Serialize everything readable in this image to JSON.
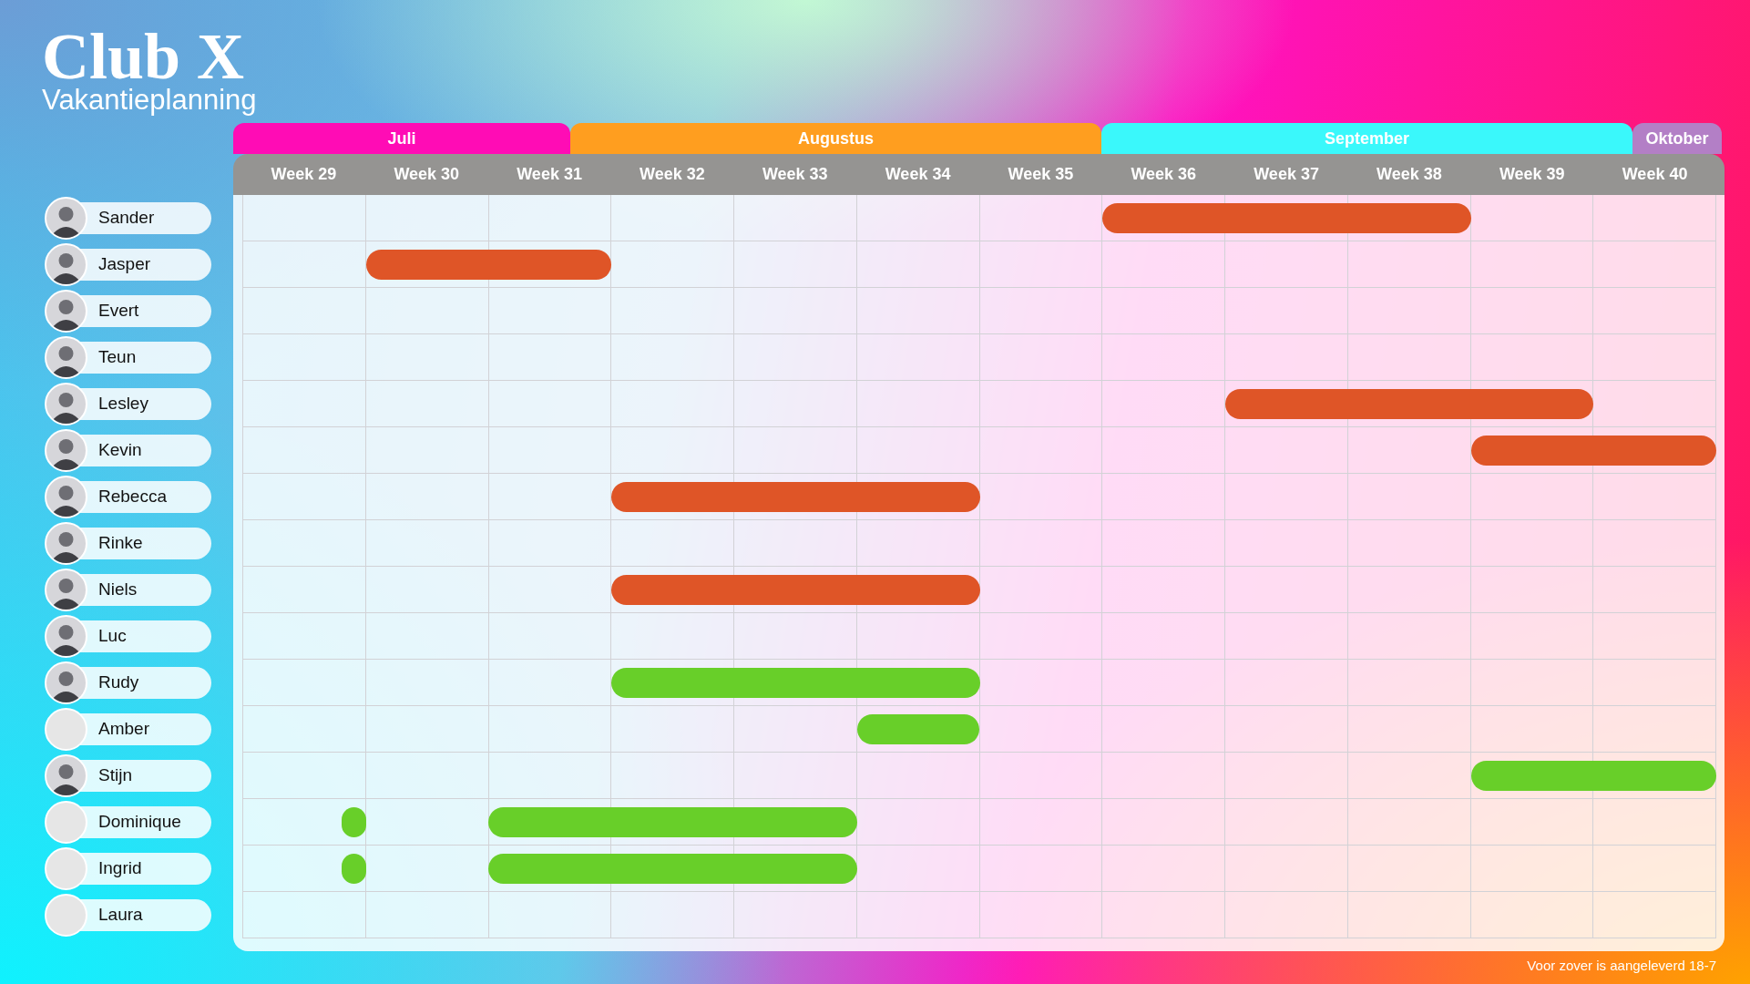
{
  "header": {
    "title": "Club X",
    "subtitle": "Vakantieplanning"
  },
  "months": [
    {
      "label": "Juli",
      "color": "#ff0cb5"
    },
    {
      "label": "Augustus",
      "color": "#ff9e1f"
    },
    {
      "label": "September",
      "color": "#3af8fb"
    },
    {
      "label": "Oktober",
      "color": "#b37fc6"
    }
  ],
  "weeks": [
    "Week 29",
    "Week 30",
    "Week 31",
    "Week 32",
    "Week 33",
    "Week 34",
    "Week 35",
    "Week 36",
    "Week 37",
    "Week 38",
    "Week 39",
    "Week 40"
  ],
  "people": [
    {
      "name": "Sander",
      "photo": true,
      "color": "#df5527",
      "schedule": [
        {
          "kind": "free"
        },
        {
          "kind": "free"
        },
        {
          "kind": "free"
        },
        {
          "kind": "free"
        },
        {
          "kind": "free"
        },
        {
          "kind": "free"
        },
        {
          "kind": "free"
        },
        {
          "kind": "week"
        },
        {
          "kind": "week"
        },
        {
          "kind": "week"
        },
        {
          "kind": "free"
        },
        {
          "kind": "free"
        }
      ]
    },
    {
      "name": "Jasper",
      "photo": true,
      "color": "#df5527",
      "schedule": [
        {
          "kind": "free"
        },
        {
          "kind": "week"
        },
        {
          "kind": "week"
        },
        {
          "kind": "free"
        },
        {
          "kind": "free"
        },
        {
          "kind": "free"
        },
        {
          "kind": "free"
        },
        {
          "kind": "free"
        },
        {
          "kind": "free"
        },
        {
          "kind": "free"
        },
        {
          "kind": "free"
        },
        {
          "kind": "free"
        }
      ]
    },
    {
      "name": "Evert",
      "photo": true,
      "schedule": [
        {
          "kind": "free"
        },
        {
          "kind": "free"
        },
        {
          "kind": "free"
        },
        {
          "kind": "free"
        },
        {
          "kind": "free"
        },
        {
          "kind": "free"
        },
        {
          "kind": "free"
        },
        {
          "kind": "free"
        },
        {
          "kind": "free"
        },
        {
          "kind": "free"
        },
        {
          "kind": "free"
        },
        {
          "kind": "free"
        }
      ]
    },
    {
      "name": "Teun",
      "photo": true,
      "schedule": [
        {
          "kind": "free"
        },
        {
          "kind": "free"
        },
        {
          "kind": "free"
        },
        {
          "kind": "free"
        },
        {
          "kind": "free"
        },
        {
          "kind": "free"
        },
        {
          "kind": "free"
        },
        {
          "kind": "free"
        },
        {
          "kind": "free"
        },
        {
          "kind": "free"
        },
        {
          "kind": "free"
        },
        {
          "kind": "free"
        }
      ]
    },
    {
      "name": "Lesley",
      "photo": true,
      "color": "#df5527",
      "schedule": [
        {
          "kind": "free"
        },
        {
          "kind": "free"
        },
        {
          "kind": "free"
        },
        {
          "kind": "free"
        },
        {
          "kind": "free"
        },
        {
          "kind": "free"
        },
        {
          "kind": "free"
        },
        {
          "kind": "free"
        },
        {
          "kind": "week"
        },
        {
          "kind": "week"
        },
        {
          "kind": "week"
        },
        {
          "kind": "free"
        }
      ]
    },
    {
      "name": "Kevin",
      "photo": true,
      "color": "#df5527",
      "schedule": [
        {
          "kind": "free"
        },
        {
          "kind": "free"
        },
        {
          "kind": "free"
        },
        {
          "kind": "free"
        },
        {
          "kind": "free"
        },
        {
          "kind": "free"
        },
        {
          "kind": "free"
        },
        {
          "kind": "free"
        },
        {
          "kind": "free"
        },
        {
          "kind": "free"
        },
        {
          "kind": "week"
        },
        {
          "kind": "week"
        }
      ]
    },
    {
      "name": "Rebecca",
      "photo": true,
      "color": "#df5527",
      "schedule": [
        {
          "kind": "free"
        },
        {
          "kind": "free"
        },
        {
          "kind": "free"
        },
        {
          "kind": "week"
        },
        {
          "kind": "week"
        },
        {
          "kind": "week"
        },
        {
          "kind": "free"
        },
        {
          "kind": "free"
        },
        {
          "kind": "free"
        },
        {
          "kind": "free"
        },
        {
          "kind": "free"
        },
        {
          "kind": "free"
        }
      ]
    },
    {
      "name": "Rinke",
      "photo": true,
      "schedule": [
        {
          "kind": "free"
        },
        {
          "kind": "free"
        },
        {
          "kind": "free"
        },
        {
          "kind": "free"
        },
        {
          "kind": "free"
        },
        {
          "kind": "free"
        },
        {
          "kind": "free"
        },
        {
          "kind": "free"
        },
        {
          "kind": "free"
        },
        {
          "kind": "free"
        },
        {
          "kind": "free"
        },
        {
          "kind": "free"
        }
      ]
    },
    {
      "name": "Niels",
      "photo": true,
      "color": "#df5527",
      "schedule": [
        {
          "kind": "free"
        },
        {
          "kind": "free"
        },
        {
          "kind": "free"
        },
        {
          "kind": "week"
        },
        {
          "kind": "week"
        },
        {
          "kind": "week"
        },
        {
          "kind": "free"
        },
        {
          "kind": "free"
        },
        {
          "kind": "free"
        },
        {
          "kind": "free"
        },
        {
          "kind": "free"
        },
        {
          "kind": "free"
        }
      ]
    },
    {
      "name": "Luc",
      "photo": true,
      "schedule": [
        {
          "kind": "free"
        },
        {
          "kind": "free"
        },
        {
          "kind": "free"
        },
        {
          "kind": "free"
        },
        {
          "kind": "free"
        },
        {
          "kind": "free"
        },
        {
          "kind": "free"
        },
        {
          "kind": "free"
        },
        {
          "kind": "free"
        },
        {
          "kind": "free"
        },
        {
          "kind": "free"
        },
        {
          "kind": "free"
        }
      ]
    },
    {
      "name": "Rudy",
      "photo": true,
      "color": "#68cf29",
      "schedule": [
        {
          "kind": "free"
        },
        {
          "kind": "free"
        },
        {
          "kind": "free"
        },
        {
          "kind": "week"
        },
        {
          "kind": "week"
        },
        {
          "kind": "week"
        },
        {
          "kind": "free"
        },
        {
          "kind": "free"
        },
        {
          "kind": "free"
        },
        {
          "kind": "free"
        },
        {
          "kind": "free"
        },
        {
          "kind": "free"
        }
      ]
    },
    {
      "name": "Amber",
      "photo": false,
      "color": "#68cf29",
      "schedule": [
        {
          "kind": "free"
        },
        {
          "kind": "free"
        },
        {
          "kind": "free"
        },
        {
          "kind": "free"
        },
        {
          "kind": "free"
        },
        {
          "kind": "week"
        },
        {
          "kind": "free"
        },
        {
          "kind": "free"
        },
        {
          "kind": "free"
        },
        {
          "kind": "free"
        },
        {
          "kind": "free"
        },
        {
          "kind": "free"
        }
      ]
    },
    {
      "name": "Stijn",
      "photo": true,
      "color": "#68cf29",
      "schedule": [
        {
          "kind": "free"
        },
        {
          "kind": "free"
        },
        {
          "kind": "free"
        },
        {
          "kind": "free"
        },
        {
          "kind": "free"
        },
        {
          "kind": "free"
        },
        {
          "kind": "free"
        },
        {
          "kind": "free"
        },
        {
          "kind": "free"
        },
        {
          "kind": "free"
        },
        {
          "kind": "week"
        },
        {
          "kind": "week"
        }
      ]
    },
    {
      "name": "Dominique",
      "photo": false,
      "color": "#68cf29",
      "schedule": [
        {
          "kind": "day"
        },
        {
          "kind": "free"
        },
        {
          "kind": "week"
        },
        {
          "kind": "week"
        },
        {
          "kind": "week"
        },
        {
          "kind": "free"
        },
        {
          "kind": "free"
        },
        {
          "kind": "free"
        },
        {
          "kind": "free"
        },
        {
          "kind": "free"
        },
        {
          "kind": "free"
        },
        {
          "kind": "free"
        }
      ]
    },
    {
      "name": "Ingrid",
      "photo": false,
      "color": "#68cf29",
      "schedule": [
        {
          "kind": "day"
        },
        {
          "kind": "free"
        },
        {
          "kind": "week"
        },
        {
          "kind": "week"
        },
        {
          "kind": "week"
        },
        {
          "kind": "free"
        },
        {
          "kind": "free"
        },
        {
          "kind": "free"
        },
        {
          "kind": "free"
        },
        {
          "kind": "free"
        },
        {
          "kind": "free"
        },
        {
          "kind": "free"
        }
      ]
    },
    {
      "name": "Laura",
      "photo": false,
      "schedule": [
        {
          "kind": "free"
        },
        {
          "kind": "free"
        },
        {
          "kind": "free"
        },
        {
          "kind": "free"
        },
        {
          "kind": "free"
        },
        {
          "kind": "free"
        },
        {
          "kind": "free"
        },
        {
          "kind": "free"
        },
        {
          "kind": "free"
        },
        {
          "kind": "free"
        },
        {
          "kind": "free"
        },
        {
          "kind": "free"
        }
      ]
    }
  ],
  "footer": "Voor zover is aangeleverd 18-7"
}
